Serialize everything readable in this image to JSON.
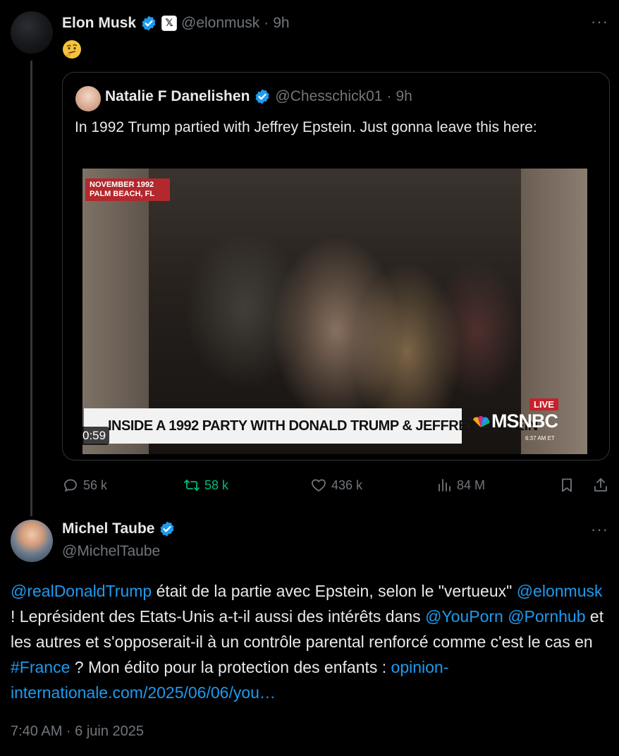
{
  "main_post": {
    "author_name": "Elon Musk",
    "handle": "@elonmusk",
    "time": "9h",
    "affiliate_badge": "𝕏",
    "emoji": "thinking-face"
  },
  "quoted_post": {
    "author_name": "Natalie F Danelishen",
    "handle": "@Chesschick01",
    "time": "9h",
    "text": "In 1992 Trump partied with Jeffrey Epstein. Just gonna leave this here:",
    "video": {
      "duration": "0:59",
      "date_tag_line1": "NOVEMBER 1992",
      "date_tag_line2": "PALM BEACH, FL",
      "chyron": "INSIDE A 1992 PARTY WITH DONALD TRUMP & JEFFREY EPSTEIN",
      "live": "LIVE",
      "network": "MSNBC",
      "network_time": "6:37 AM ET"
    }
  },
  "actions": {
    "replies": "56 k",
    "reposts": "58 k",
    "likes": "436 k",
    "views": "84 M"
  },
  "reply_post": {
    "author_name": "Michel Taube",
    "handle": "@MichelTaube",
    "mention1": "@realDonaldTrump",
    "text1": " était de la partie avec Epstein, selon le \"vertueux\" ",
    "mention2": "@elonmusk",
    "text2": " ! Leprésident des Etats-Unis a-t-il aussi des intérêts dans ",
    "mention3": "@YouPorn",
    "mention4": "@Pornhub",
    "text3": " et les autres et s'opposerait-il à un contrôle parental renforcé comme c'est le cas en ",
    "hashtag": "#France",
    "text4": " ? Mon édito pour la protection des enfants : ",
    "link": "opinion-internationale.com/2025/06/06/you…",
    "timestamp": "7:40 AM · 6 juin 2025"
  },
  "colors": {
    "background": "#000000",
    "text": "#e7e9ea",
    "muted": "#71767b",
    "link": "#1d9bf0",
    "repost_active": "#00ba7c",
    "verified": "#1d9bf0"
  }
}
